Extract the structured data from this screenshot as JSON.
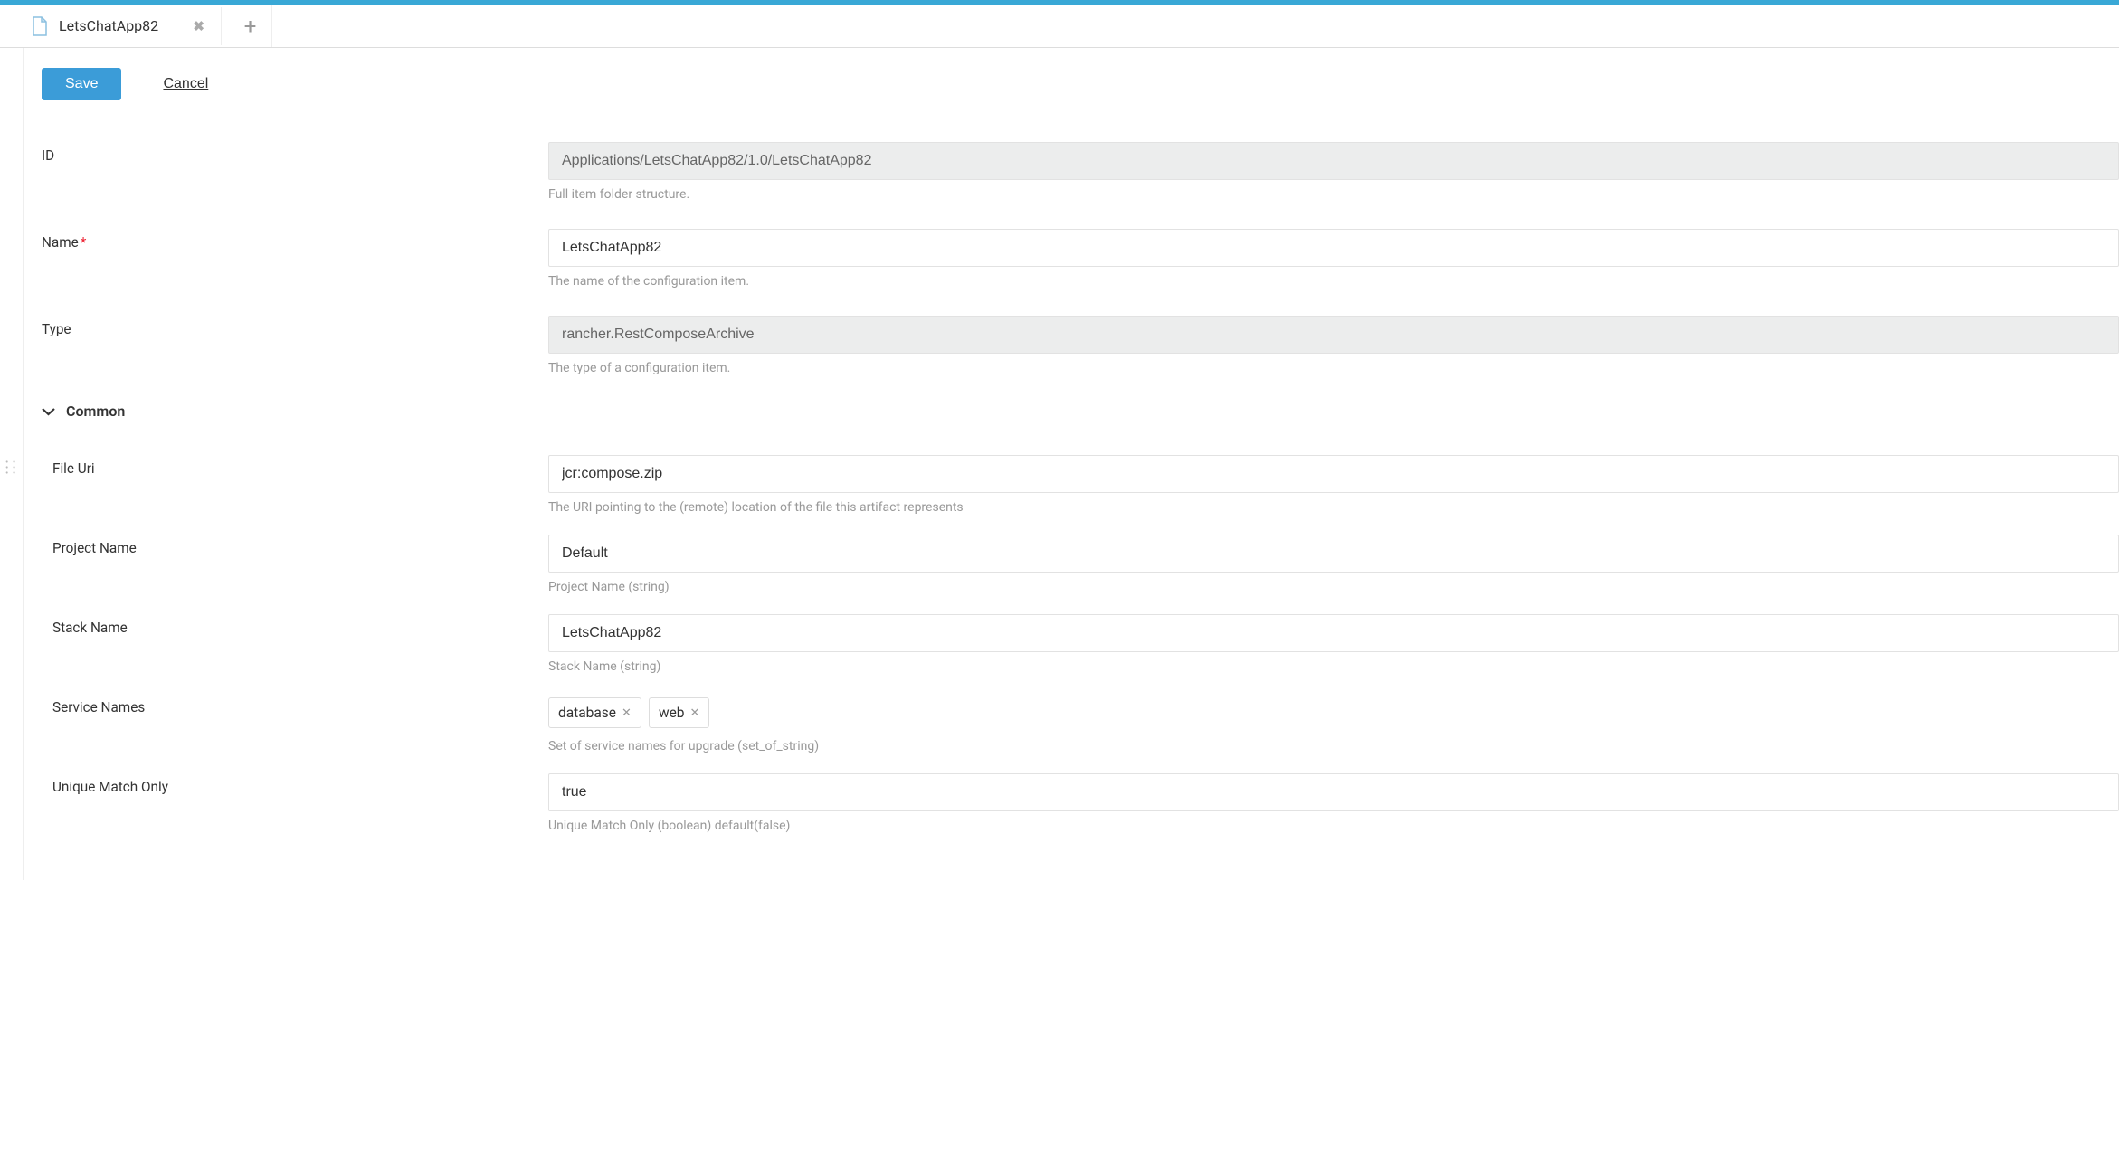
{
  "tab": {
    "title": "LetsChatApp82"
  },
  "actions": {
    "save": "Save",
    "cancel": "Cancel"
  },
  "fields": {
    "id": {
      "label": "ID",
      "value": "Applications/LetsChatApp82/1.0/LetsChatApp82",
      "hint": "Full item folder structure."
    },
    "name": {
      "label": "Name",
      "value": "LetsChatApp82",
      "hint": "The name of the configuration item."
    },
    "type": {
      "label": "Type",
      "value": "rancher.RestComposeArchive",
      "hint": "The type of a configuration item."
    }
  },
  "section": {
    "title": "Common"
  },
  "common": {
    "fileUri": {
      "label": "File Uri",
      "value": "jcr:compose.zip",
      "hint": "The URI pointing to the (remote) location of the file this artifact represents"
    },
    "projectName": {
      "label": "Project Name",
      "value": "Default",
      "hint": "Project Name (string)"
    },
    "stackName": {
      "label": "Stack Name",
      "value": "LetsChatApp82",
      "hint": "Stack Name (string)"
    },
    "serviceNames": {
      "label": "Service Names",
      "tags": [
        "database",
        "web"
      ],
      "hint": "Set of service names for upgrade (set_of_string)"
    },
    "uniqueMatchOnly": {
      "label": "Unique Match Only",
      "value": "true",
      "hint": "Unique Match Only (boolean) default(false)"
    }
  }
}
